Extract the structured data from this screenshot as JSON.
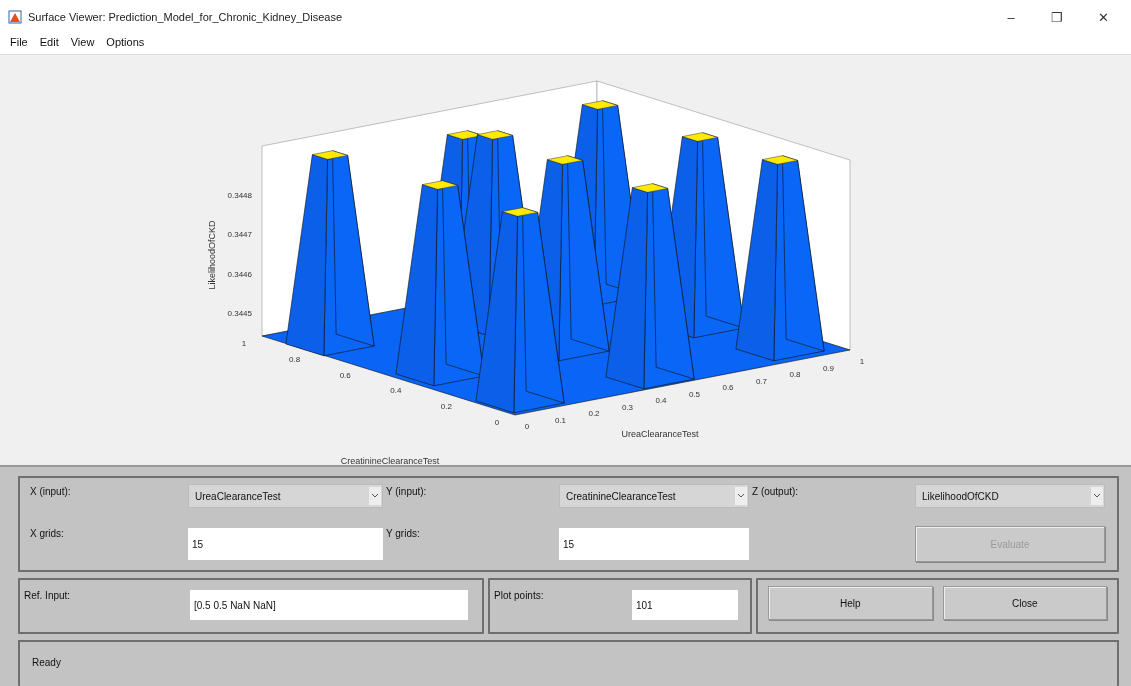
{
  "window": {
    "title": "Surface Viewer: Prediction_Model_for_Chronic_Kidney_Disease",
    "controls": [
      "–",
      "❐",
      "✕"
    ]
  },
  "menu": [
    {
      "label": "File"
    },
    {
      "label": "Edit"
    },
    {
      "label": "View"
    },
    {
      "label": "Options"
    }
  ],
  "plot": {
    "zlabel": "LikelihoodOfCKD",
    "xlabel": "UreaClearanceTest",
    "ylabel": "CreatinineClearanceTest",
    "zticks": [
      "0.3448",
      "0.3447",
      "0.3446",
      "0.3445"
    ],
    "yticks": [
      "1",
      "0.8",
      "0.6",
      "0.4",
      "0.2",
      "0"
    ],
    "xticks": [
      "0",
      "0.1",
      "0.2",
      "0.3",
      "0.4",
      "0.5",
      "0.6",
      "0.7",
      "0.8",
      "0.9",
      "1"
    ]
  },
  "axes_panel": {
    "x_input": {
      "label": "X (input):",
      "value": "UreaClearanceTest"
    },
    "y_input": {
      "label": "Y (input):",
      "value": "CreatinineClearanceTest"
    },
    "z_output": {
      "label": "Z (output):",
      "value": "LikelihoodOfCKD"
    },
    "x_grids": {
      "label": "X grids:",
      "value": "15"
    },
    "y_grids": {
      "label": "Y grids:",
      "value": "15"
    },
    "evaluate": {
      "label": "Evaluate",
      "disabled": true
    }
  },
  "ref_input": {
    "label": "Ref. Input:",
    "value": "[0.5 0.5 NaN NaN]"
  },
  "plot_points": {
    "label": "Plot points:",
    "value": "101"
  },
  "buttons": [
    "Help",
    "Close"
  ],
  "status": "Ready"
}
